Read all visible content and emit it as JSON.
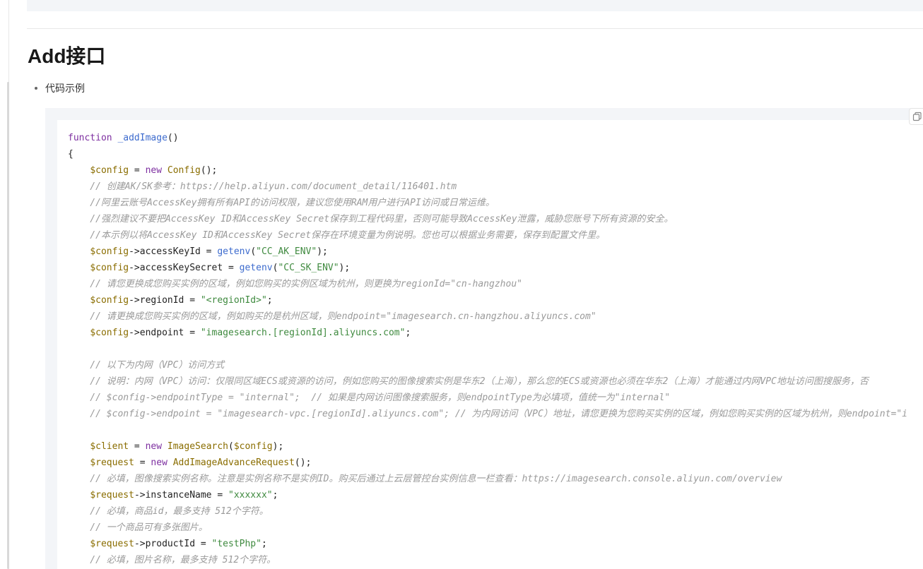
{
  "section": {
    "title": "Add接口",
    "bullet": "代码示例"
  },
  "icons": {
    "copy": "copy-icon"
  },
  "colors": {
    "keyword": "#7d2fa0",
    "function": "#3d6bce",
    "variable": "#8a6d00",
    "string": "#3f8a3f",
    "comment": "#9a9a9a",
    "plain": "#222222"
  },
  "code": [
    [
      {
        "t": "function",
        "c": "keyword"
      },
      {
        "t": " ",
        "c": "plain"
      },
      {
        "t": "_addImage",
        "c": "function"
      },
      {
        "t": "()",
        "c": "plain"
      }
    ],
    [
      {
        "t": "{",
        "c": "plain"
      }
    ],
    [
      {
        "t": "    ",
        "c": "plain"
      },
      {
        "t": "$config",
        "c": "variable"
      },
      {
        "t": " = ",
        "c": "plain"
      },
      {
        "t": "new",
        "c": "keyword"
      },
      {
        "t": " ",
        "c": "plain"
      },
      {
        "t": "Config",
        "c": "variable"
      },
      {
        "t": "();",
        "c": "plain"
      }
    ],
    [
      {
        "t": "    // 创建AK/SK参考：https://help.aliyun.com/document_detail/116401.htm",
        "c": "comment"
      }
    ],
    [
      {
        "t": "    //阿里云账号AccessKey拥有所有API的访问权限，建议您使用RAM用户进行API访问或日常运维。",
        "c": "comment"
      }
    ],
    [
      {
        "t": "    //强烈建议不要把AccessKey ID和AccessKey Secret保存到工程代码里，否则可能导致AccessKey泄露，威胁您账号下所有资源的安全。",
        "c": "comment"
      }
    ],
    [
      {
        "t": "    //本示例以将AccessKey ID和AccessKey Secret保存在环境变量为例说明。您也可以根据业务需要，保存到配置文件里。",
        "c": "comment"
      }
    ],
    [
      {
        "t": "    ",
        "c": "plain"
      },
      {
        "t": "$config",
        "c": "variable"
      },
      {
        "t": "->accessKeyId = ",
        "c": "plain"
      },
      {
        "t": "getenv",
        "c": "function"
      },
      {
        "t": "(",
        "c": "plain"
      },
      {
        "t": "\"CC_AK_ENV\"",
        "c": "string"
      },
      {
        "t": ");",
        "c": "plain"
      }
    ],
    [
      {
        "t": "    ",
        "c": "plain"
      },
      {
        "t": "$config",
        "c": "variable"
      },
      {
        "t": "->accessKeySecret = ",
        "c": "plain"
      },
      {
        "t": "getenv",
        "c": "function"
      },
      {
        "t": "(",
        "c": "plain"
      },
      {
        "t": "\"CC_SK_ENV\"",
        "c": "string"
      },
      {
        "t": ");",
        "c": "plain"
      }
    ],
    [
      {
        "t": "    // 请您更换成您购买实例的区域，例如您购买的实例区域为杭州，则更换为regionId=\"cn-hangzhou\"",
        "c": "comment"
      }
    ],
    [
      {
        "t": "    ",
        "c": "plain"
      },
      {
        "t": "$config",
        "c": "variable"
      },
      {
        "t": "->regionId = ",
        "c": "plain"
      },
      {
        "t": "\"<regionId>\"",
        "c": "string"
      },
      {
        "t": ";",
        "c": "plain"
      }
    ],
    [
      {
        "t": "    // 请更换成您购买实例的区域，例如购买的是杭州区域，则endpoint=\"imagesearch.cn-hangzhou.aliyuncs.com\"",
        "c": "comment"
      }
    ],
    [
      {
        "t": "    ",
        "c": "plain"
      },
      {
        "t": "$config",
        "c": "variable"
      },
      {
        "t": "->endpoint = ",
        "c": "plain"
      },
      {
        "t": "\"imagesearch.[regionId].aliyuncs.com\"",
        "c": "string"
      },
      {
        "t": ";",
        "c": "plain"
      }
    ],
    [
      {
        "t": " ",
        "c": "plain"
      }
    ],
    [
      {
        "t": "    // 以下为内网（VPC）访问方式",
        "c": "comment"
      }
    ],
    [
      {
        "t": "    // 说明：内网（VPC）访问：仅限同区域ECS或资源的访问，例如您购买的图像搜索实例是华东2（上海），那么您的ECS或资源也必须在华东2（上海）才能通过内网VPC地址访问图搜服务，否",
        "c": "comment"
      }
    ],
    [
      {
        "t": "    // $config->endpointType = \"internal\";  // 如果是内网访问图像搜索服务，则endpointType为必填项，值统一为\"internal\"",
        "c": "comment"
      }
    ],
    [
      {
        "t": "    // $config->endpoint = \"imagesearch-vpc.[regionId].aliyuncs.com\"; // 为内网访问（VPC）地址，请您更换为您购买实例的区域，例如您购买实例的区域为杭州，则endpoint=\"i",
        "c": "comment"
      }
    ],
    [
      {
        "t": " ",
        "c": "plain"
      }
    ],
    [
      {
        "t": "    ",
        "c": "plain"
      },
      {
        "t": "$client",
        "c": "variable"
      },
      {
        "t": " = ",
        "c": "plain"
      },
      {
        "t": "new",
        "c": "keyword"
      },
      {
        "t": " ",
        "c": "plain"
      },
      {
        "t": "ImageSearch",
        "c": "variable"
      },
      {
        "t": "(",
        "c": "plain"
      },
      {
        "t": "$config",
        "c": "variable"
      },
      {
        "t": ");",
        "c": "plain"
      }
    ],
    [
      {
        "t": "    ",
        "c": "plain"
      },
      {
        "t": "$request",
        "c": "variable"
      },
      {
        "t": " = ",
        "c": "plain"
      },
      {
        "t": "new",
        "c": "keyword"
      },
      {
        "t": " ",
        "c": "plain"
      },
      {
        "t": "AddImageAdvanceRequest",
        "c": "variable"
      },
      {
        "t": "();",
        "c": "plain"
      }
    ],
    [
      {
        "t": "    // 必填，图像搜索实例名称。注意是实例名称不是实例ID。购买后通过上云层管控台实例信息一栏查看：https://imagesearch.console.aliyun.com/overview",
        "c": "comment"
      }
    ],
    [
      {
        "t": "    ",
        "c": "plain"
      },
      {
        "t": "$request",
        "c": "variable"
      },
      {
        "t": "->instanceName = ",
        "c": "plain"
      },
      {
        "t": "\"xxxxxx\"",
        "c": "string"
      },
      {
        "t": ";",
        "c": "plain"
      }
    ],
    [
      {
        "t": "    // 必填，商品id，最多支持 512个字符。",
        "c": "comment"
      }
    ],
    [
      {
        "t": "    // 一个商品可有多张图片。",
        "c": "comment"
      }
    ],
    [
      {
        "t": "    ",
        "c": "plain"
      },
      {
        "t": "$request",
        "c": "variable"
      },
      {
        "t": "->productId = ",
        "c": "plain"
      },
      {
        "t": "\"testPhp\"",
        "c": "string"
      },
      {
        "t": ";",
        "c": "plain"
      }
    ],
    [
      {
        "t": "    // 必填，图片名称，最多支持 512个字符。",
        "c": "comment"
      }
    ]
  ]
}
